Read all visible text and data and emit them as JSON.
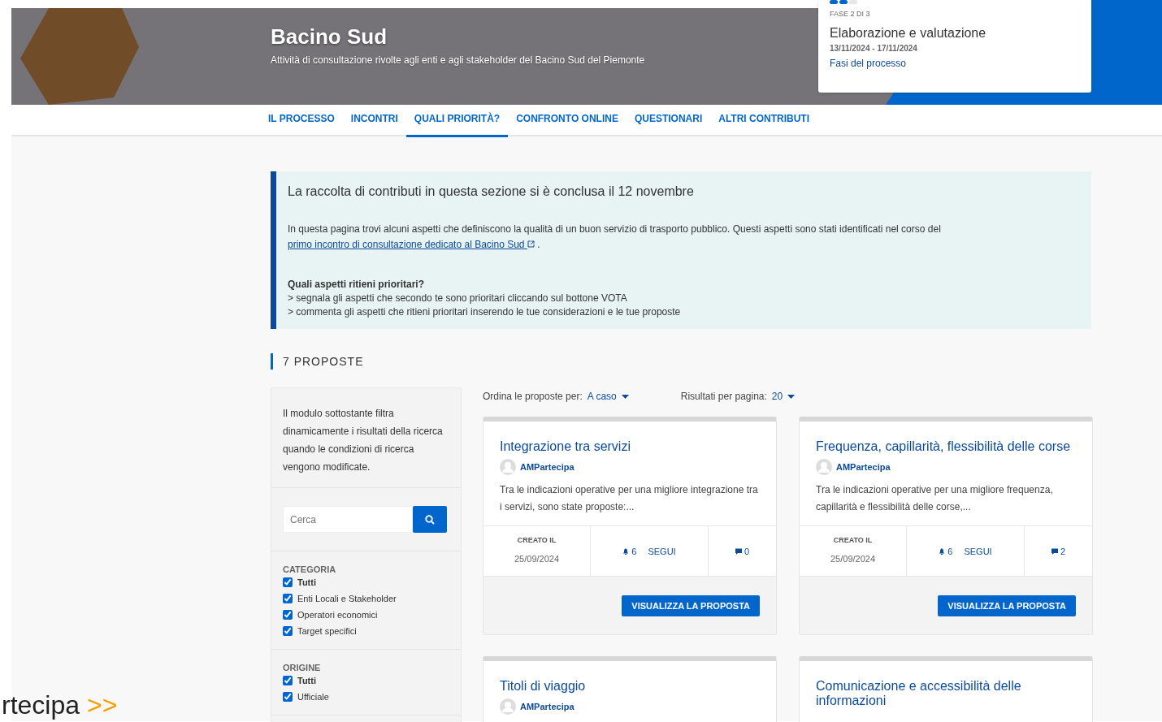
{
  "banner": {
    "title": "Bacino Sud",
    "subtitle": "Attività di consultazione rivolte agli enti e agli stakeholder del Bacino Sud del Piemonte"
  },
  "phase": {
    "step": "FASE 2 DI 3",
    "title": "Elaborazione e valutazione",
    "dates": "13/11/2024 - 17/11/2024",
    "link": "Fasi del processo"
  },
  "tabs": [
    {
      "label": "IL PROCESSO",
      "selected": false
    },
    {
      "label": "INCONTRI",
      "selected": false
    },
    {
      "label": "QUALI PRIORITÀ?",
      "selected": true
    },
    {
      "label": "CONFRONTO ONLINE",
      "selected": false
    },
    {
      "label": "QUESTIONARI",
      "selected": false
    },
    {
      "label": "ALTRI CONTRIBUTI",
      "selected": false
    }
  ],
  "notice": {
    "heading": "La raccolta di contributi in questa sezione si è conclusa il 12 novembre",
    "text": "In questa pagina trovi alcuni aspetti che definiscono  la qualità di un buon servizio di trasporto pubblico. Questi aspetti sono stati identificati nel corso del",
    "link": "primo incontro di consultazione dedicato al Bacino Sud",
    "after": ".",
    "question": "Quali aspetti ritieni prioritari?",
    "steps": [
      "> segnala gli aspetti che secondo te sono prioritari cliccando sul bottone VOTA",
      "> commenta gli aspetti che ritieni prioritari inserendo le tue considerazioni e le tue proposte"
    ]
  },
  "count": "7 PROPOSTE",
  "filter": {
    "intro": "Il modulo sottostante filtra dinamicamente i risultati della ricerca quando le condizioni di ricerca vengono modificate.",
    "search": {
      "placeholder": "Cerca"
    },
    "groups": [
      {
        "title": "CATEGORIA",
        "options": [
          {
            "label": "Tutti",
            "checked": true
          },
          {
            "label": "Enti Locali e Stakeholder",
            "checked": true
          },
          {
            "label": "Operatori economici",
            "checked": true
          },
          {
            "label": "Target specifici",
            "checked": true
          }
        ]
      },
      {
        "title": "ORIGINE",
        "options": [
          {
            "label": "Tutti",
            "checked": true
          },
          {
            "label": "Ufficiale",
            "checked": true
          }
        ]
      }
    ]
  },
  "sort": {
    "label": "Ordina le proposte per:",
    "value": "A caso"
  },
  "per_page": {
    "label": "Risultati per pagina:",
    "value": "20"
  },
  "cards": [
    {
      "title": "Integrazione tra servizi",
      "author": "AMPartecipa",
      "excerpt": "Tra le indicazioni operative per una migliore integrazione tra i servizi, sono state proposte:...",
      "created_label": "CREATO IL",
      "created": "25/09/2024",
      "followers": "6",
      "follow": "SEGUI",
      "comments": "0",
      "button": "VISUALIZZA LA PROPOSTA"
    },
    {
      "title": "Frequenza, capillarità, flessibilità delle corse",
      "author": "AMPartecipa",
      "excerpt": "Tra le indicazioni operative per una migliore frequenza, capillarità e flessibilità delle corse,...",
      "created_label": "CREATO IL",
      "created": "25/09/2024",
      "followers": "6",
      "follow": "SEGUI",
      "comments": "2",
      "button": "VISUALIZZA LA PROPOSTA"
    },
    {
      "title": "Titoli di viaggio",
      "author": "AMPartecipa"
    },
    {
      "title": "Comunicazione e accessibilità delle informazioni"
    }
  ],
  "overlay": {
    "text": "rtecipa",
    "arrows": ">>"
  }
}
